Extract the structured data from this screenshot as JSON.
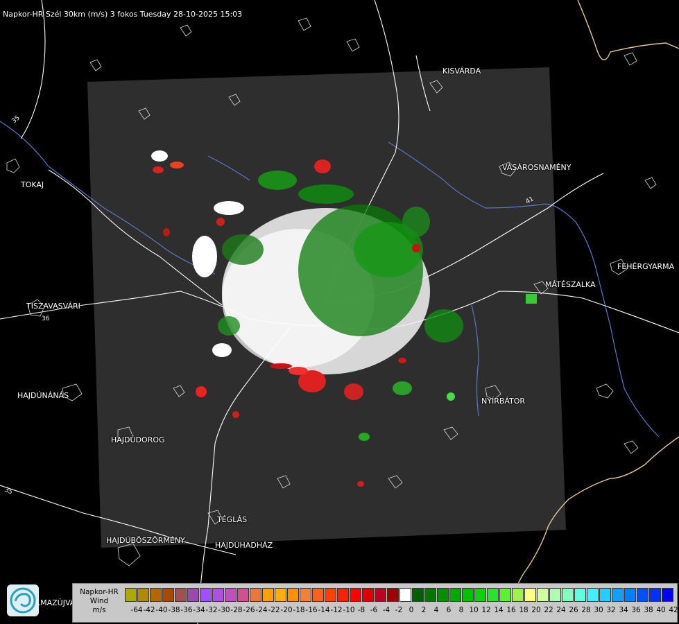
{
  "header": {
    "title": "Napkor-HR Szél 30km (m/s) 3 fokos Tuesday 28-10-2025 15:03"
  },
  "cities": [
    {
      "id": "kisvarda",
      "name": "KISVÁRDA"
    },
    {
      "id": "tokaj",
      "name": "TOKAJ"
    },
    {
      "id": "vasarosnameny",
      "name": "VÁSÁROSNAMÉNY"
    },
    {
      "id": "fehergyarmat",
      "name": "FEHÉRGYARMA"
    },
    {
      "id": "mateszalka",
      "name": "MÁTÉSZALKA"
    },
    {
      "id": "tiszavasvari",
      "name": "TISZAVASVÁRI"
    },
    {
      "id": "nyirbator",
      "name": "NYÍRBÁTOR"
    },
    {
      "id": "hajdunanas",
      "name": "HAJDÚNÁNÁS"
    },
    {
      "id": "hajdudorog",
      "name": "HAJDÚDOROG"
    },
    {
      "id": "teglas",
      "name": "TÉGLÁS"
    },
    {
      "id": "hajduboszormeny",
      "name": "HAJDÚBÖSZÖRMÉNY"
    },
    {
      "id": "hajduhadhaz",
      "name": "HAJDÚHADHÁZ"
    }
  ],
  "roads": [
    {
      "id": "r35",
      "label": "35"
    },
    {
      "id": "r36",
      "label": "36"
    },
    {
      "id": "r41",
      "label": "41"
    }
  ],
  "legend": {
    "source_line1": "Napkor-HR",
    "source_line2": "Wind",
    "unit": "m/s",
    "bins": [
      {
        "value": "-64",
        "color": "#aaaa00"
      },
      {
        "value": "-42",
        "color": "#b08a00"
      },
      {
        "value": "-40",
        "color": "#b06a00"
      },
      {
        "value": "-38",
        "color": "#aa4a00"
      },
      {
        "value": "-36",
        "color": "#a05050"
      },
      {
        "value": "-34",
        "color": "#9a4aaa"
      },
      {
        "value": "-32",
        "color": "#a050ff"
      },
      {
        "value": "-30",
        "color": "#b050e0"
      },
      {
        "value": "-28",
        "color": "#c050c0"
      },
      {
        "value": "-26",
        "color": "#d05090"
      },
      {
        "value": "-24",
        "color": "#e87840"
      },
      {
        "value": "-22",
        "color": "#ffa000"
      },
      {
        "value": "-20",
        "color": "#ffb000"
      },
      {
        "value": "-18",
        "color": "#ff9000"
      },
      {
        "value": "-16",
        "color": "#f08040"
      },
      {
        "value": "-14",
        "color": "#ff6020"
      },
      {
        "value": "-12",
        "color": "#ff4000"
      },
      {
        "value": "-10",
        "color": "#ff2000"
      },
      {
        "value": "-8",
        "color": "#ff0000"
      },
      {
        "value": "-6",
        "color": "#e00000"
      },
      {
        "value": "-4",
        "color": "#c00020"
      },
      {
        "value": "-2",
        "color": "#a00000"
      },
      {
        "value": "0",
        "color": "#ffffff"
      },
      {
        "value": "2",
        "color": "#006000"
      },
      {
        "value": "4",
        "color": "#007800"
      },
      {
        "value": "6",
        "color": "#009000"
      },
      {
        "value": "8",
        "color": "#00a800"
      },
      {
        "value": "10",
        "color": "#00c000"
      },
      {
        "value": "12",
        "color": "#10d010"
      },
      {
        "value": "14",
        "color": "#30e030"
      },
      {
        "value": "16",
        "color": "#60f030"
      },
      {
        "value": "18",
        "color": "#a0f050"
      },
      {
        "value": "20",
        "color": "#ffff80"
      },
      {
        "value": "22",
        "color": "#d0ffa0"
      },
      {
        "value": "24",
        "color": "#b0ffb0"
      },
      {
        "value": "26",
        "color": "#80ffc0"
      },
      {
        "value": "28",
        "color": "#60ffe0"
      },
      {
        "value": "30",
        "color": "#40f0ff"
      },
      {
        "value": "32",
        "color": "#20d0ff"
      },
      {
        "value": "34",
        "color": "#10a0ff"
      },
      {
        "value": "36",
        "color": "#0080ff"
      },
      {
        "value": "38",
        "color": "#0050ff"
      },
      {
        "value": "40",
        "color": "#0030ff"
      },
      {
        "value": "42",
        "color": "#0000ff"
      }
    ]
  },
  "logo": {
    "icon": "swirl-logo-icon",
    "text": "LMAZÚJVÁR"
  }
}
